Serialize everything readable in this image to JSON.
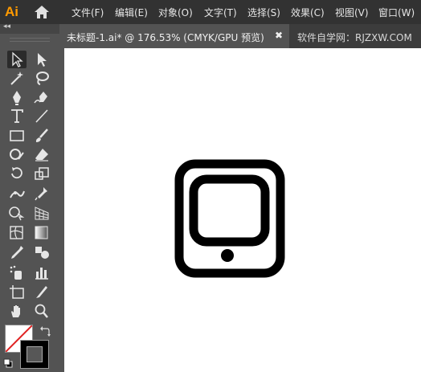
{
  "app": {
    "logo_text": "Ai",
    "home_icon": "home-icon"
  },
  "menu": [
    "文件(F)",
    "编辑(E)",
    "对象(O)",
    "文字(T)",
    "选择(S)",
    "效果(C)",
    "视图(V)",
    "窗口(W)"
  ],
  "tabs": {
    "active": {
      "label": "未标题-1.ai* @ 176.53% (CMYK/GPU 预览)",
      "close": "✖"
    },
    "second": {
      "label": "软件自学网：RJZXW.COM"
    }
  },
  "toolbar": {
    "collapse": "◂◂",
    "tools": [
      "selection-tool",
      "direct-selection-tool",
      "magic-wand-tool",
      "lasso-tool",
      "pen-tool",
      "curvature-tool",
      "type-tool",
      "line-segment-tool",
      "rectangle-tool",
      "paintbrush-tool",
      "shaper-tool",
      "eraser-tool",
      "rotate-tool",
      "scale-tool",
      "width-tool",
      "puppet-warp-tool",
      "shape-builder-tool",
      "perspective-grid-tool",
      "mesh-tool",
      "gradient-tool",
      "eyedropper-tool",
      "blend-tool",
      "symbol-sprayer-tool",
      "column-graph-tool",
      "artboard-tool",
      "slice-tool",
      "hand-tool",
      "zoom-tool"
    ],
    "fill_color": "#ffffff",
    "stroke_color": "#000000"
  },
  "canvas": {
    "background": "#ffffff",
    "artwork": "tablet-icon-artwork"
  }
}
